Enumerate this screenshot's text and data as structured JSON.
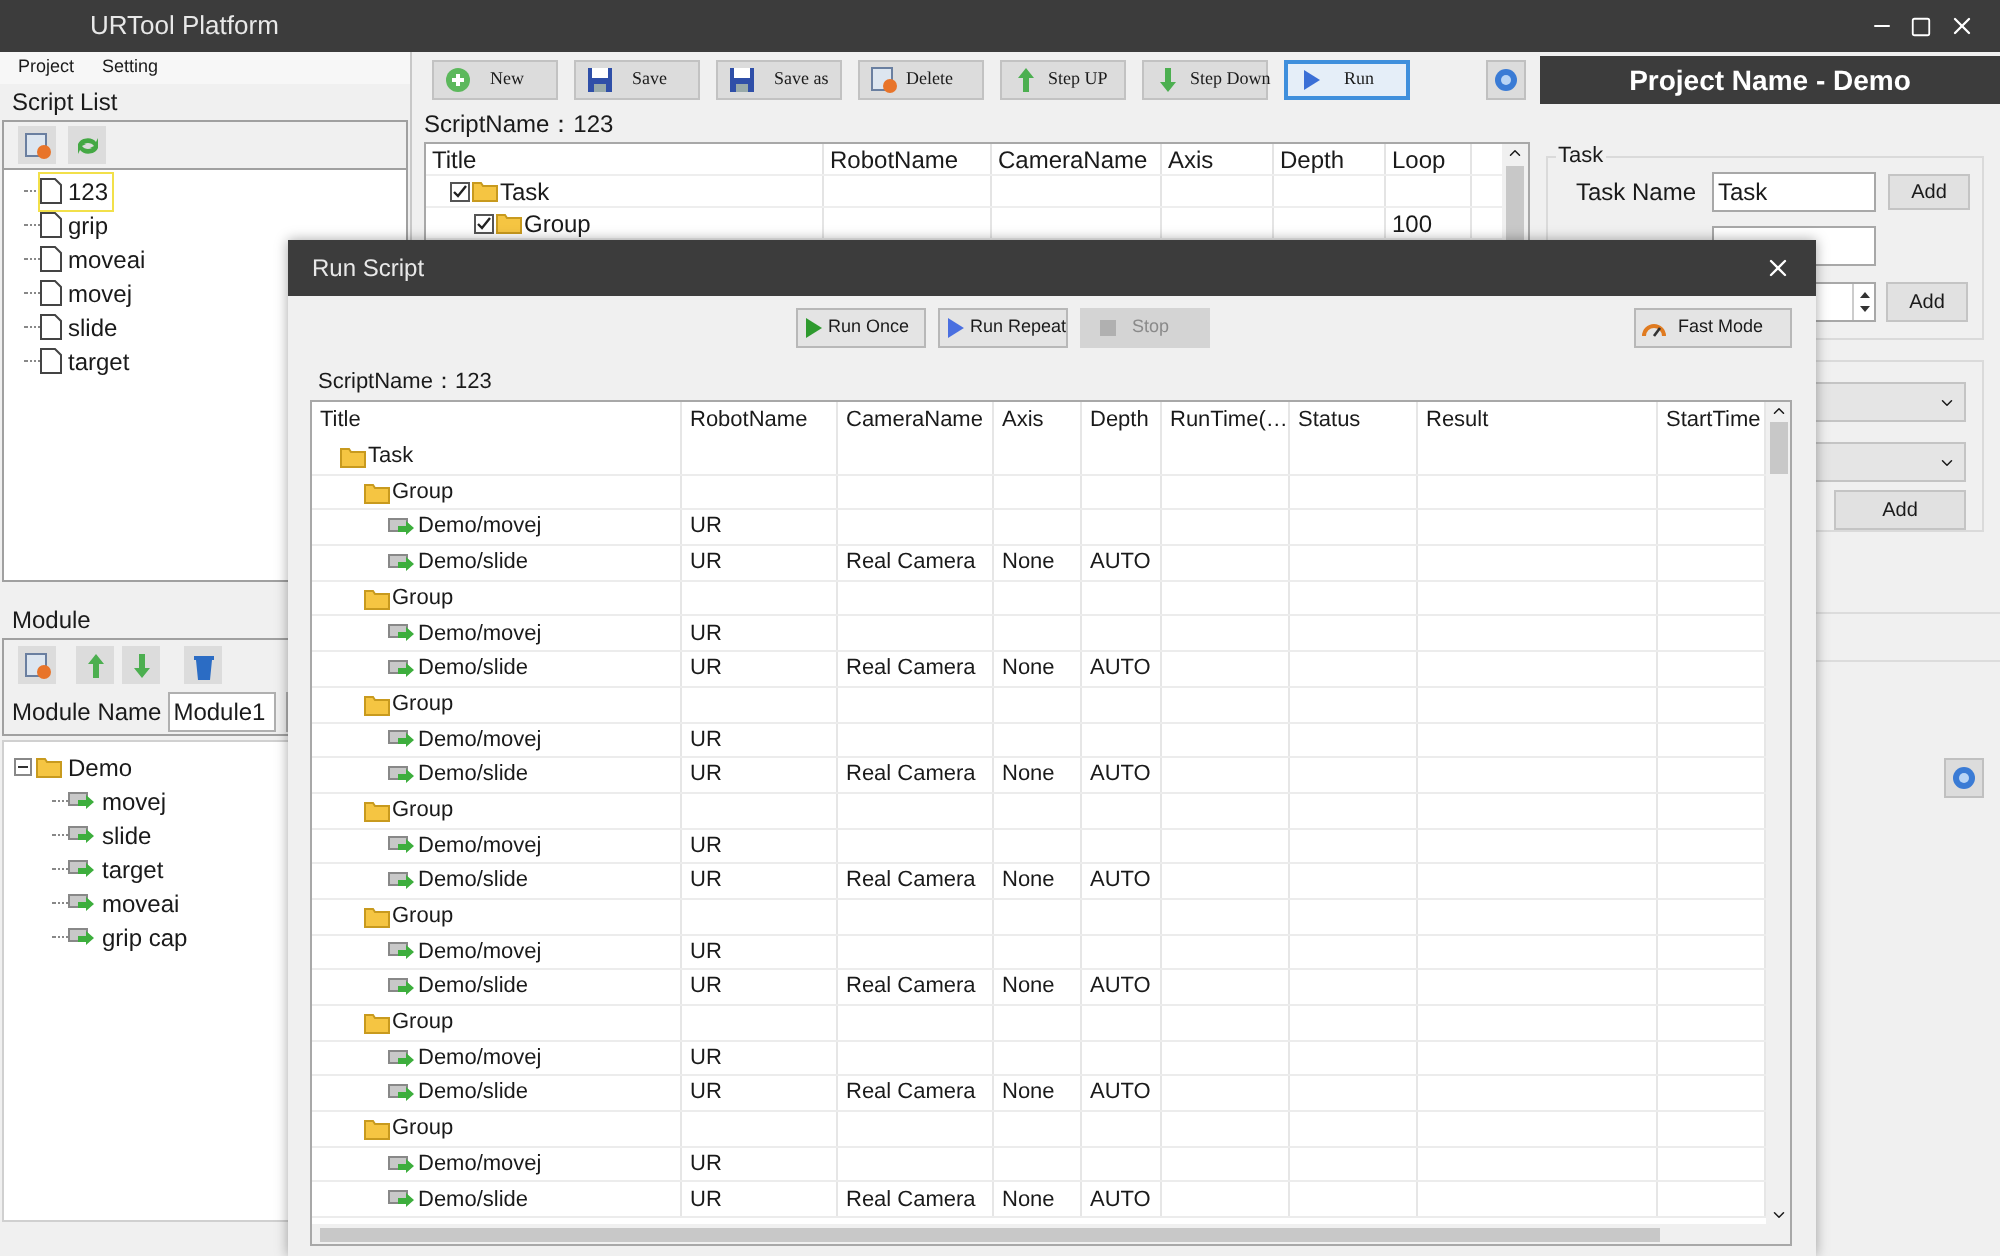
{
  "window": {
    "title": "URTool Platform"
  },
  "menu": [
    "Project",
    "Setting"
  ],
  "script_list": {
    "title": "Script List",
    "items": [
      {
        "label": "123",
        "selected": true
      },
      {
        "label": "grip",
        "selected": false
      },
      {
        "label": "moveai",
        "selected": false
      },
      {
        "label": "movej",
        "selected": false
      },
      {
        "label": "slide",
        "selected": false
      },
      {
        "label": "target",
        "selected": false
      }
    ]
  },
  "module": {
    "title": "Module",
    "name_label": "Module Name",
    "name_value": "Module1",
    "tree": [
      {
        "label": "Demo",
        "expanded": true,
        "children": [
          {
            "label": "movej"
          },
          {
            "label": "slide"
          },
          {
            "label": "target"
          },
          {
            "label": "moveai"
          },
          {
            "label": "grip cap"
          }
        ]
      }
    ]
  },
  "toolbar": {
    "buttons": [
      {
        "label": "New",
        "kind": "new",
        "selected": false
      },
      {
        "label": "Save",
        "kind": "save",
        "selected": false
      },
      {
        "label": "Save as",
        "kind": "save",
        "selected": false
      },
      {
        "label": "Delete",
        "kind": "delete",
        "selected": false
      },
      {
        "label": "Step UP",
        "kind": "up",
        "selected": false
      },
      {
        "label": "Step Down",
        "kind": "down",
        "selected": false
      },
      {
        "label": "Run",
        "kind": "run",
        "selected": true
      }
    ]
  },
  "script_name": "ScriptName：123",
  "main_table": {
    "columns": [
      "Title",
      "RobotName",
      "CameraName",
      "Axis",
      "Depth",
      "Loop"
    ],
    "rows": [
      {
        "title": "Task",
        "checked": true,
        "loop": ""
      },
      {
        "title": "Group",
        "checked": true,
        "loop": "100"
      }
    ]
  },
  "project_banner": "Project Name - Demo",
  "task_panel": {
    "title": "Task",
    "task_name_label": "Task Name",
    "task_name_value": "Task",
    "add_buttons": [
      "Add",
      "Add",
      "Add"
    ]
  },
  "dialog": {
    "title": "Run Script",
    "buttons": [
      {
        "label": "Run Once",
        "kind": "once",
        "disabled": false
      },
      {
        "label": "Run Repeat",
        "kind": "repeat",
        "disabled": false
      },
      {
        "label": "Stop",
        "kind": "stop",
        "disabled": true
      }
    ],
    "fast_mode": "Fast Mode",
    "script_name": "ScriptName：123",
    "table": {
      "columns": [
        "Title",
        "RobotName",
        "CameraName",
        "Axis",
        "Depth",
        "RunTime(…",
        "Status",
        "Result",
        "StartTime"
      ],
      "rows": [
        {
          "title": "Task",
          "kind": "folder",
          "children": [
            {
              "title": "Group",
              "kind": "folder",
              "children": [
                {
                  "title": "Demo/movej",
                  "kind": "module",
                  "robot": "UR"
                },
                {
                  "title": "Demo/slide",
                  "kind": "module",
                  "robot": "UR",
                  "camera": "Real Camera",
                  "axis": "None",
                  "depth": "AUTO"
                }
              ]
            },
            {
              "title": "Group",
              "kind": "folder",
              "children": [
                {
                  "title": "Demo/movej",
                  "kind": "module",
                  "robot": "UR"
                },
                {
                  "title": "Demo/slide",
                  "kind": "module",
                  "robot": "UR",
                  "camera": "Real Camera",
                  "axis": "None",
                  "depth": "AUTO"
                }
              ]
            },
            {
              "title": "Group",
              "kind": "folder",
              "children": [
                {
                  "title": "Demo/movej",
                  "kind": "module",
                  "robot": "UR"
                },
                {
                  "title": "Demo/slide",
                  "kind": "module",
                  "robot": "UR",
                  "camera": "Real Camera",
                  "axis": "None",
                  "depth": "AUTO"
                }
              ]
            },
            {
              "title": "Group",
              "kind": "folder",
              "children": [
                {
                  "title": "Demo/movej",
                  "kind": "module",
                  "robot": "UR"
                },
                {
                  "title": "Demo/slide",
                  "kind": "module",
                  "robot": "UR",
                  "camera": "Real Camera",
                  "axis": "None",
                  "depth": "AUTO"
                }
              ]
            },
            {
              "title": "Group",
              "kind": "folder",
              "children": [
                {
                  "title": "Demo/movej",
                  "kind": "module",
                  "robot": "UR"
                },
                {
                  "title": "Demo/slide",
                  "kind": "module",
                  "robot": "UR",
                  "camera": "Real Camera",
                  "axis": "None",
                  "depth": "AUTO"
                }
              ]
            },
            {
              "title": "Group",
              "kind": "folder",
              "children": [
                {
                  "title": "Demo/movej",
                  "kind": "module",
                  "robot": "UR"
                },
                {
                  "title": "Demo/slide",
                  "kind": "module",
                  "robot": "UR",
                  "camera": "Real Camera",
                  "axis": "None",
                  "depth": "AUTO"
                }
              ]
            },
            {
              "title": "Group",
              "kind": "folder",
              "children": [
                {
                  "title": "Demo/movej",
                  "kind": "module",
                  "robot": "UR"
                },
                {
                  "title": "Demo/slide",
                  "kind": "module",
                  "robot": "UR",
                  "camera": "Real Camera",
                  "axis": "None",
                  "depth": "AUTO"
                }
              ]
            }
          ]
        }
      ]
    }
  }
}
